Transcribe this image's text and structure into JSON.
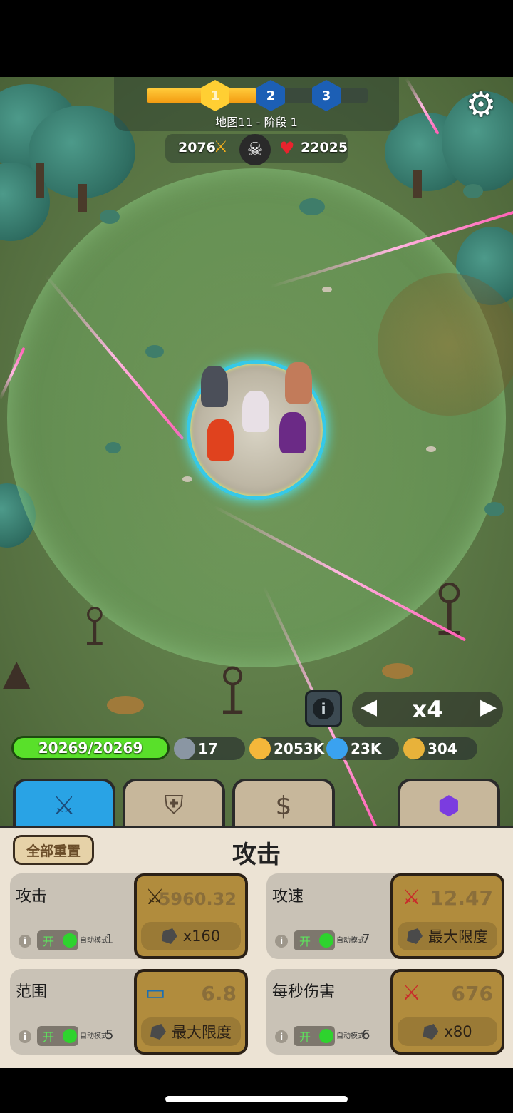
{
  "stage": {
    "progress": 0.5,
    "checkpoints": [
      "1",
      "2",
      "3"
    ],
    "label": "地图11  -  阶段 1"
  },
  "battle": {
    "kills": "2076",
    "base_hp": "22025"
  },
  "controls": {
    "speed": "x4"
  },
  "resources": {
    "hp": "20269/20269",
    "stones": "17",
    "coins": "2053K",
    "gems": "23K",
    "tokens": "304"
  },
  "tabs": [
    "attack",
    "defense",
    "economy",
    "crystal"
  ],
  "panel": {
    "reset_label": "全部重置",
    "title": "攻击"
  },
  "cards": [
    {
      "name": "攻击",
      "toggle": "开",
      "auto_label": "自动模式",
      "auto_level": "1",
      "value": "5960.32",
      "cost": "x160"
    },
    {
      "name": "攻速",
      "toggle": "开",
      "auto_label": "自动模式",
      "auto_level": "7",
      "value": "12.47",
      "cost": "最大限度"
    },
    {
      "name": "范围",
      "toggle": "开",
      "auto_label": "自动模式",
      "auto_level": "5",
      "value": "6.8",
      "cost": "最大限度"
    },
    {
      "name": "每秒伤害",
      "toggle": "开",
      "auto_label": "自动模式",
      "auto_level": "6",
      "value": "676",
      "cost": "x80"
    }
  ],
  "colors": {
    "progress_fill": "#f5a623",
    "hp_bar": "#59e02a",
    "active_tab": "#29a3e5",
    "upgrade_button": "#b18c3d",
    "range_ring": "#36c9e8"
  },
  "icons": {
    "settings": "gear-icon",
    "kills": "skull-icon",
    "hp": "heart-icon",
    "speed_prev": "triangle-left-icon",
    "speed_next": "triangle-right-icon"
  }
}
